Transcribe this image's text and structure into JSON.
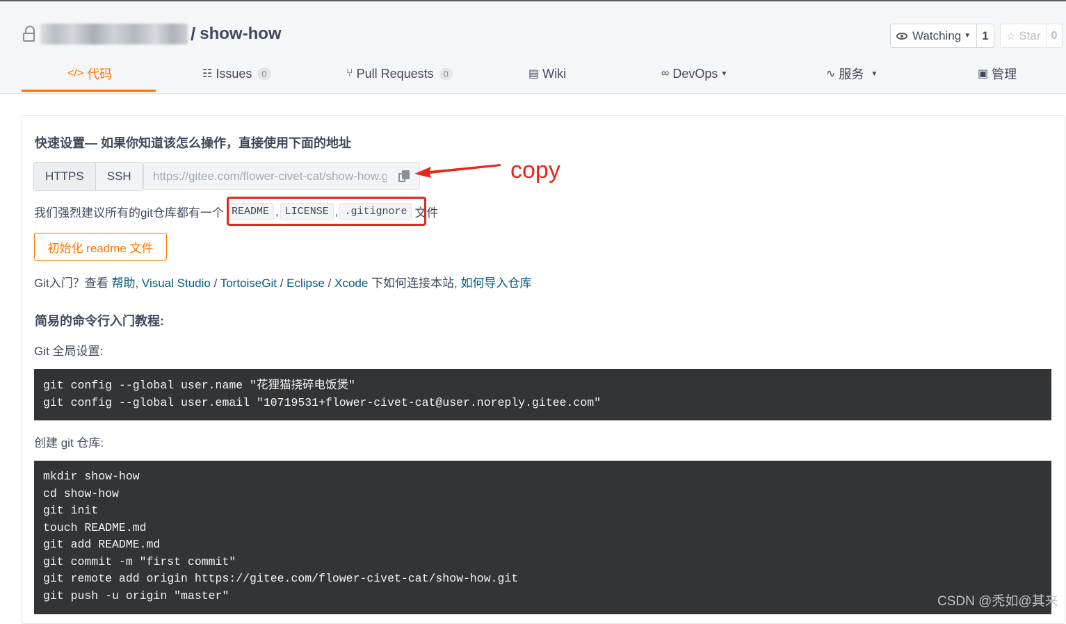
{
  "repo": {
    "owner_blurred": true,
    "separator": "/",
    "name": "show-how"
  },
  "actions": {
    "watch_label": "Watching",
    "watch_count": "1",
    "star_label": "Star",
    "star_count": "0"
  },
  "tabs": [
    {
      "label": "代码",
      "icon": "code-icon",
      "active": true
    },
    {
      "label": "Issues",
      "badge": "0",
      "icon": "issues-icon"
    },
    {
      "label": "Pull Requests",
      "badge": "0",
      "icon": "pull-request-icon"
    },
    {
      "label": "Wiki",
      "icon": "wiki-icon"
    },
    {
      "label": "DevOps",
      "icon": "devops-icon",
      "dropdown": true
    },
    {
      "label": "服务",
      "icon": "pulse-icon",
      "dropdown": true
    },
    {
      "label": "管理",
      "icon": "manage-icon"
    }
  ],
  "quick_setup": {
    "heading": "快速设置— 如果你知道该怎么操作，直接使用下面的地址",
    "protocols": [
      "HTTPS",
      "SSH"
    ],
    "url": "https://gitee.com/flower-civet-cat/show-how.git"
  },
  "annotation": {
    "copy_label": "copy",
    "arrow_color": "#e8251a"
  },
  "recommend": {
    "prefix": "我们强烈建议所有的git仓库都有一个",
    "files": [
      "README",
      "LICENSE",
      ".gitignore"
    ],
    "suffix": "文件"
  },
  "init_button": "初始化 readme 文件",
  "help": {
    "prefix": "Git入门？查看",
    "links": [
      "帮助",
      "Visual Studio",
      "TortoiseGit",
      "Eclipse",
      "Xcode"
    ],
    "middle": "下如何连接本站,",
    "import_link": "如何导入仓库"
  },
  "tutorial": {
    "heading": "简易的命令行入门教程:",
    "global_label": "Git 全局设置:",
    "global_code": [
      "git config --global user.name \"花狸猫挠碎电饭煲\"",
      "git config --global user.email \"10719531+flower-civet-cat@user.noreply.gitee.com\""
    ],
    "create_label": "创建 git 仓库:",
    "create_code": [
      "mkdir show-how",
      "cd show-how",
      "git init",
      "touch README.md",
      "git add README.md",
      "git commit -m \"first commit\"",
      "git remote add origin https://gitee.com/flower-civet-cat/show-how.git",
      "git push -u origin \"master\""
    ]
  },
  "watermark": "CSDN @秃如@其来",
  "colors": {
    "accent": "#fe7300",
    "link": "#005980",
    "code_bg": "#333436",
    "annotation_red": "#e8251a"
  }
}
